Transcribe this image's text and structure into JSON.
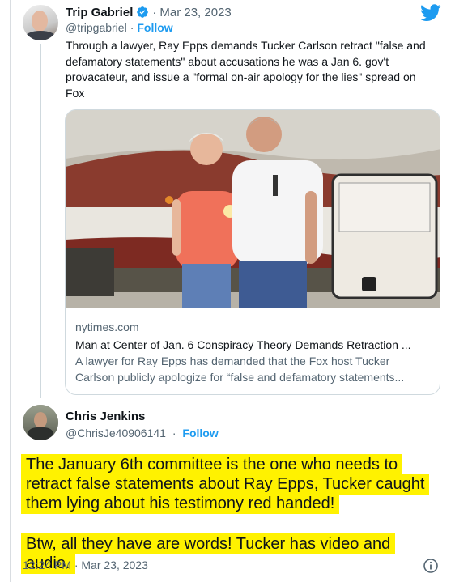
{
  "tweet": {
    "author_name": "Trip Gabriel",
    "handle": "@tripgabriel",
    "follow_label": "Follow",
    "date": "Mar 23, 2023",
    "text": "Through a lawyer, Ray Epps demands Tucker Carlson retract \"false and defamatory statements\" about accusations he was a Jan 6. gov't provacateur, and issue a \"formal on-air apology for the lies\" spread on Fox",
    "card": {
      "domain": "nytimes.com",
      "title": "Man at Center of Jan. 6 Conspiracy Theory Demands Retraction ...",
      "description": "A lawyer for Ray Epps has demanded that the Fox host Tucker Carlson publicly apologize for “false and defamatory statements..."
    }
  },
  "reply": {
    "author_name": "Chris Jenkins",
    "handle": "@ChrisJe40906141",
    "follow_label": "Follow",
    "paragraph1": "The January 6th committee is the one who needs to retract false statements about Ray Epps, Tucker caught them lying about his testimony red handed!",
    "paragraph2": "Btw, all they have are words! Tucker has video and audio.",
    "timestamp": "12:24 PM · Mar 23, 2023"
  },
  "colors": {
    "accent": "#1d9bf0",
    "highlight": "#fff200",
    "secondary_text": "#536471"
  },
  "icons": {
    "verified": "verified-badge-icon",
    "brand": "twitter-bird-icon",
    "info": "info-icon"
  }
}
